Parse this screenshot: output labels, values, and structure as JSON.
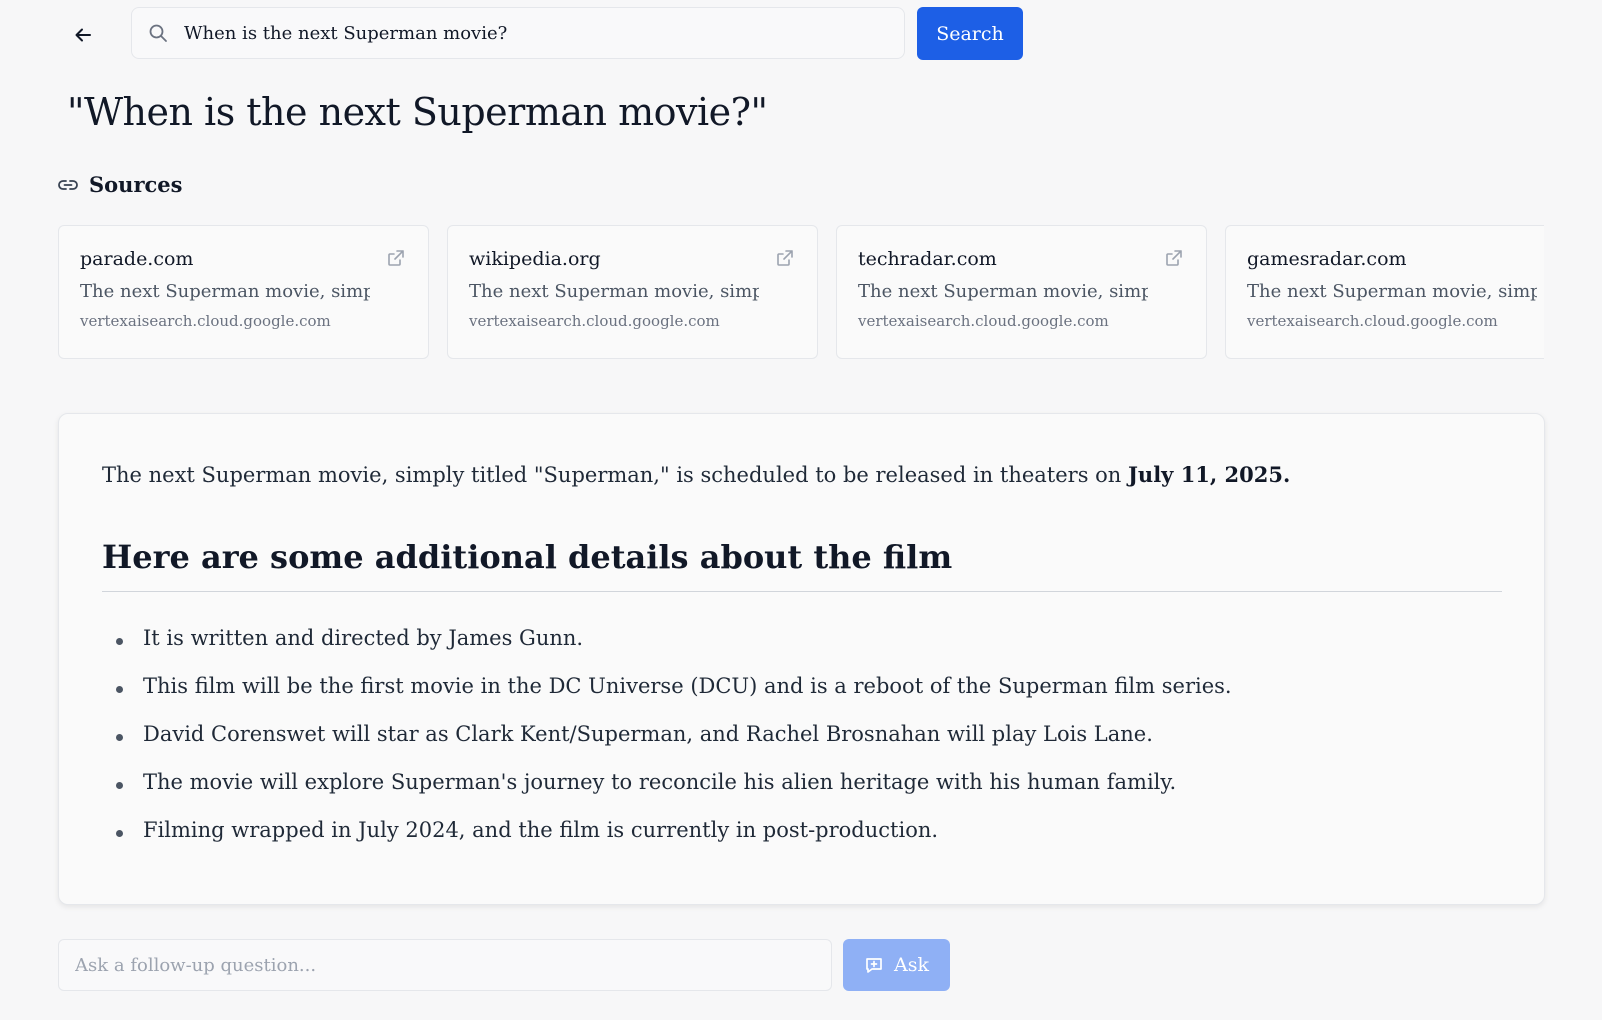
{
  "header": {
    "search_value": "When is the next Superman movie?",
    "search_button_label": "Search"
  },
  "query_title": "\"When is the next Superman movie?\"",
  "sources": {
    "heading": "Sources",
    "items": [
      {
        "domain": "parade.com",
        "snippet": "The next Superman movie, simply titled",
        "url": "vertexaisearch.cloud.google.com"
      },
      {
        "domain": "wikipedia.org",
        "snippet": "The next Superman movie, simply titled",
        "url": "vertexaisearch.cloud.google.com"
      },
      {
        "domain": "techradar.com",
        "snippet": "The next Superman movie, simply titled",
        "url": "vertexaisearch.cloud.google.com"
      },
      {
        "domain": "gamesradar.com",
        "snippet": "The next Superman movie, simply titled",
        "url": "vertexaisearch.cloud.google.com"
      }
    ]
  },
  "answer": {
    "intro": "The next Superman movie, simply titled \"Superman,\" is scheduled to be released in theaters on ",
    "intro_date": "July 11, 2025.",
    "heading": "Here are some additional details about the film",
    "details": [
      "It is written and directed by James Gunn.",
      "This film will be the first movie in the DC Universe (DCU) and is a reboot of the Superman film series.",
      "David Corenswet will star as Clark Kent/Superman, and Rachel Brosnahan will play Lois Lane.",
      "The movie will explore Superman's journey to reconcile his alien heritage with his human family.",
      "Filming wrapped in July 2024, and the film is currently in post-production."
    ]
  },
  "followup": {
    "placeholder": "Ask a follow-up question...",
    "ask_label": "Ask"
  },
  "colors": {
    "accent": "#1d5fe6",
    "accent_disabled": "#8fb0f5",
    "background": "#f7f7f8"
  }
}
